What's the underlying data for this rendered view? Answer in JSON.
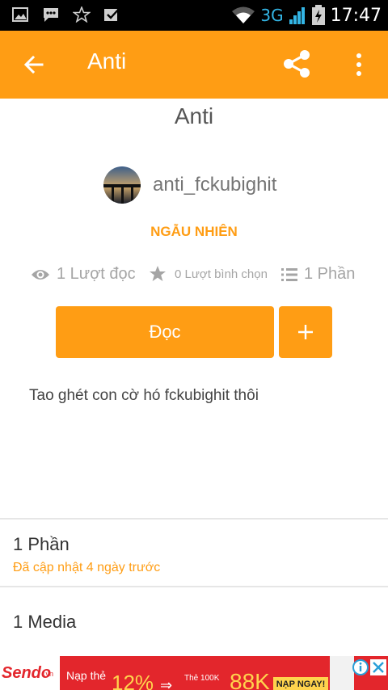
{
  "status_bar": {
    "network": "3G",
    "time": "17:47",
    "left_icons": [
      "image-icon",
      "chat-icon",
      "star-outline-icon",
      "check-icon"
    ],
    "right_icons": [
      "wifi-icon",
      "signal-icon",
      "battery-icon"
    ]
  },
  "app_bar": {
    "title": "Anti",
    "back_icon": "arrow-left-icon",
    "share_icon": "share-icon",
    "more_icon": "more-vert-icon",
    "color": "#ff9d14"
  },
  "story": {
    "title": "Anti",
    "author": "anti_fckubighit",
    "category": "NGẪU NHIÊN",
    "stats": {
      "reads": "1 Lượt đọc",
      "votes": "0 Lượt bình chọn",
      "parts": "1 Phần"
    },
    "read_button": "Đọc",
    "add_button": "+",
    "description": "Tao ghét con cờ hó fckubighit thôi"
  },
  "sections": {
    "parts": {
      "title": "1 Phần",
      "subtitle": "Đã cập nhật 4 ngày trước"
    },
    "media": {
      "title": "1 Media"
    }
  },
  "ad": {
    "brand": "Sendo",
    "brand_tld": ".vn",
    "text1": "Nạp thẻ",
    "percent": "12%",
    "text2": "Thẻ 100K",
    "amount": "88K",
    "cta": "NẠP NGAY!"
  },
  "colors": {
    "accent": "#ff9d14",
    "status_bar": "#000000",
    "ad_bg": "#e3262c"
  }
}
